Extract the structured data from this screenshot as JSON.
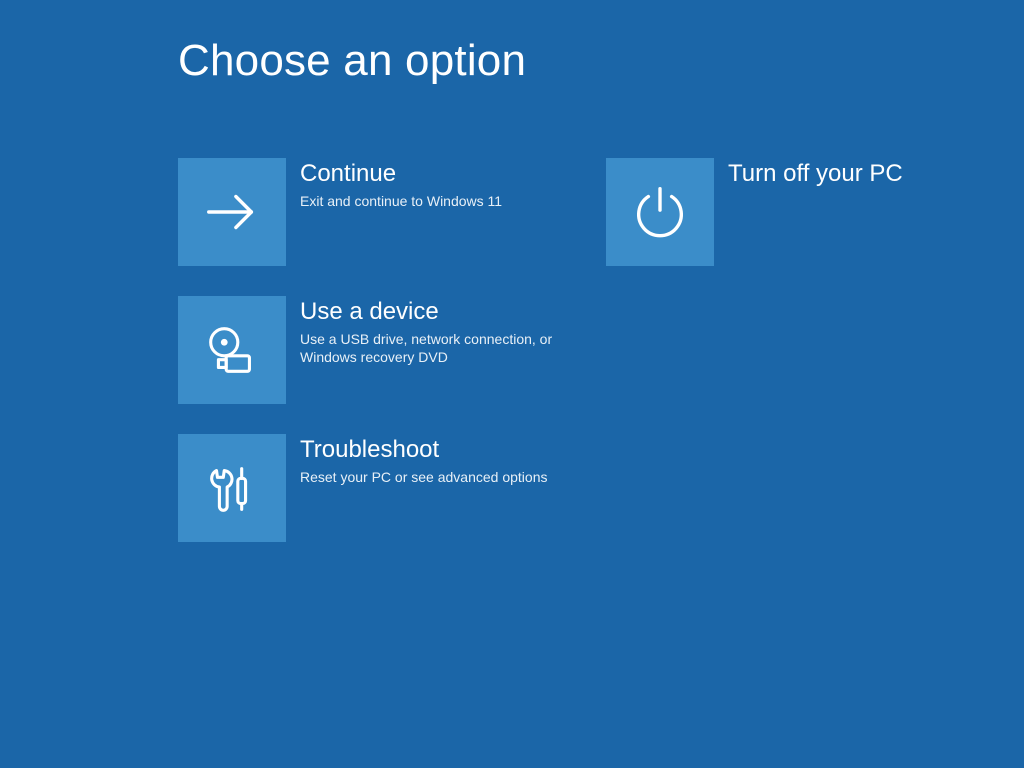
{
  "heading": "Choose an option",
  "options": {
    "continue": {
      "title": "Continue",
      "desc": "Exit and continue to Windows 11"
    },
    "use_device": {
      "title": "Use a device",
      "desc": "Use a USB drive, network connection, or Windows recovery DVD"
    },
    "troubleshoot": {
      "title": "Troubleshoot",
      "desc": "Reset your PC or see advanced options"
    },
    "turn_off": {
      "title": "Turn off your PC",
      "desc": ""
    }
  },
  "colors": {
    "background": "#1b66a8",
    "tile": "#3b8dc9",
    "text": "#ffffff"
  }
}
